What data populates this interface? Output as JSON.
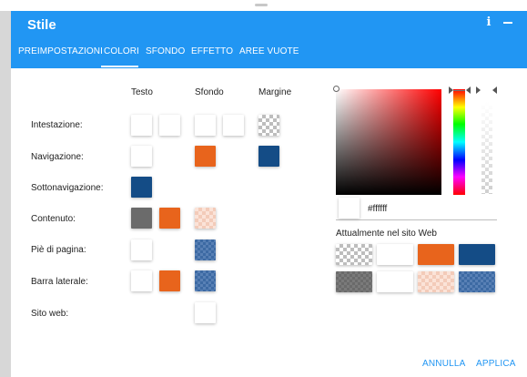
{
  "dialog": {
    "title": "Stile",
    "info_icon_text": "i"
  },
  "tabs": [
    "PREIMPOSTAZIONI",
    "COLORI",
    "SFONDO",
    "EFFETTO",
    "AREE VUOTE"
  ],
  "active_tab": "COLORI",
  "columns": {
    "text": "Testo",
    "background": "Sfondo",
    "border": "Margine"
  },
  "rows": [
    {
      "label": "Intestazione:"
    },
    {
      "label": "Navigazione:"
    },
    {
      "label": "Sottonavigazione:"
    },
    {
      "label": "Contenuto:"
    },
    {
      "label": "Piè di pagina:"
    },
    {
      "label": "Barra laterale:"
    },
    {
      "label": "Sito web:"
    }
  ],
  "picker": {
    "hex_value": "#ffffff"
  },
  "current_colors": {
    "label": "Attualmente nel sito Web"
  },
  "buttons": {
    "cancel": "ANNULLA",
    "apply": "APPLICA"
  },
  "colors": {
    "accent": "#2196f3",
    "orange": "#e8641c",
    "navy": "#144c86",
    "gray": "#6b6b6b",
    "white": "#ffffff"
  }
}
